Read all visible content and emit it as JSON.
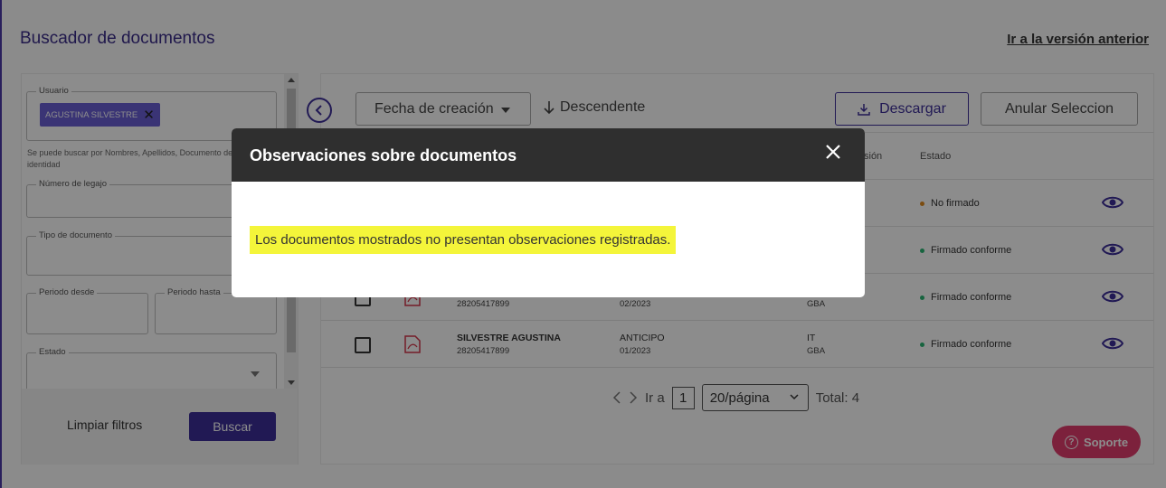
{
  "page": {
    "title": "Buscador de documentos",
    "previous_version_link": "Ir a la versión anterior"
  },
  "filters": {
    "user": {
      "label": "Usuario",
      "chip": "AGUSTINA SILVESTRE"
    },
    "user_hint": "Se puede buscar por Nombres, Apellidos, Documento de identidad",
    "file_number": {
      "label": "Número de legajo"
    },
    "document_type": {
      "label": "Tipo de documento"
    },
    "period_from": {
      "label": "Periodo desde"
    },
    "period_to": {
      "label": "Periodo hasta"
    },
    "status": {
      "label": "Estado"
    },
    "clear_button": "Limpiar filtros",
    "search_button": "Buscar"
  },
  "results": {
    "sort_field": "Fecha de creación",
    "sort_direction": "Descendente",
    "download_button": "Descargar",
    "cancel_selection_button": "Anular Seleccion",
    "columns": {
      "partial_version": "sión",
      "status": "Estado"
    },
    "rows": [
      {
        "status": "No firmado",
        "status_color": "#e08a1e"
      },
      {
        "status": "Firmado conforme",
        "status_color": "#2bb673"
      },
      {
        "name": "",
        "id": "28205417899",
        "type": "",
        "period": "02/2023",
        "company": "",
        "region": "GBA",
        "status": "Firmado conforme",
        "status_color": "#2bb673"
      },
      {
        "name": "SILVESTRE AGUSTINA",
        "id": "28205417899",
        "type": "ANTICIPO",
        "period": "01/2023",
        "company": "IT",
        "region": "GBA",
        "status": "Firmado conforme",
        "status_color": "#2bb673"
      }
    ],
    "pagination": {
      "goto_label": "Ir a",
      "current_page": "1",
      "page_size": "20/página",
      "total": "Total: 4"
    }
  },
  "support_button": "Soporte",
  "modal": {
    "title": "Observaciones sobre documentos",
    "message": "Los documentos mostrados no presentan observaciones registradas."
  },
  "colors": {
    "primary": "#3d2f9a",
    "support": "#e23d6d",
    "highlight": "#f4f53a",
    "modal_header": "#2f2f2f"
  }
}
